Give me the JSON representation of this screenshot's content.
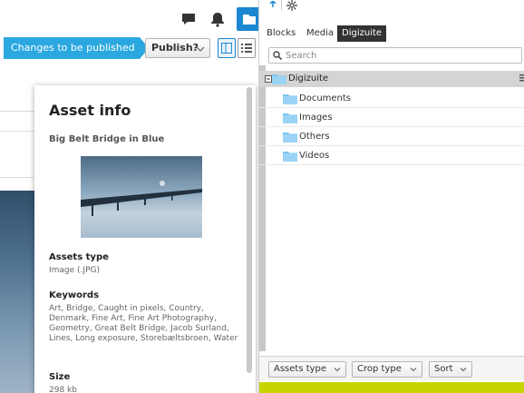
{
  "toolbar": {
    "icons": [
      "comment-icon",
      "bell-icon",
      "folder-icon"
    ],
    "changes_badge": "Changes to be published",
    "publish_label": "Publish?"
  },
  "asset_info": {
    "title": "Asset info",
    "asset_name": "Big Belt Bridge in Blue",
    "sections": [
      {
        "label": "Assets type",
        "value": "Image (.JPG)"
      },
      {
        "label": "Keywords",
        "value": "Art, Bridge, Caught in pixels, Country, Denmark, Fine Art, Fine Art Photography, Geometry, Great Belt Bridge, Jacob Surland, Lines, Long exposure, Storebæltsbroen, Water"
      },
      {
        "label": "Size",
        "value": "298 kb"
      }
    ]
  },
  "assets_panel": {
    "tabs": [
      {
        "label": "Blocks",
        "active": false
      },
      {
        "label": "Media",
        "active": false
      },
      {
        "label": "Digizuite",
        "active": true
      }
    ],
    "search": {
      "placeholder": "Search",
      "value": ""
    },
    "tree": {
      "root": "Digizuite",
      "children": [
        "Documents",
        "Images",
        "Others",
        "Videos"
      ]
    },
    "filters": {
      "assets_type": "Assets type",
      "crop_type": "Crop type",
      "sort": "Sort"
    }
  },
  "colors": {
    "accent_blue": "#2ba8e0",
    "button_blue": "#1a87d0",
    "tab_active_bg": "#333333",
    "folder_blue": "#7cc4ef",
    "footer_accent": "#c8d400"
  }
}
